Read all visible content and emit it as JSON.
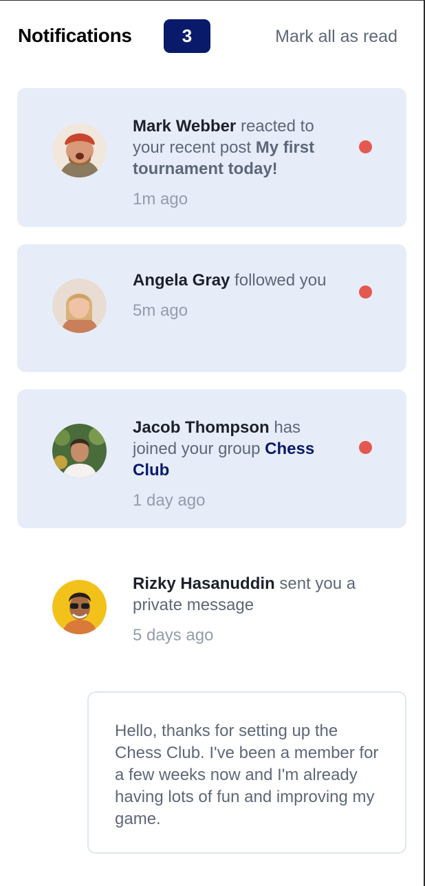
{
  "header": {
    "title": "Notifications",
    "unread_count": "3",
    "mark_all_label": "Mark all as read"
  },
  "notifications": [
    {
      "name": "Mark Webber",
      "action": " reacted to your recent post ",
      "post": "My first tournament today!",
      "time": "1m ago",
      "unread": true
    },
    {
      "name": "Angela Gray",
      "action": " followed you",
      "time": "5m ago",
      "unread": true
    },
    {
      "name": "Jacob Thompson",
      "action": " has joined your group ",
      "group": "Chess Club",
      "time": "1 day ago",
      "unread": true
    },
    {
      "name": "Rizky Hasanuddin",
      "action": " sent you a private message",
      "time": "5 days ago",
      "unread": false,
      "message": "Hello, thanks for setting up the Chess Club. I've been a member for a few weeks now and I'm already having lots of fun and improving my game."
    }
  ],
  "colors": {
    "unread_bg": "#e6edf9",
    "badge_bg": "#0a1a6b",
    "dot": "#e5584f",
    "text_muted": "#5e6778"
  }
}
